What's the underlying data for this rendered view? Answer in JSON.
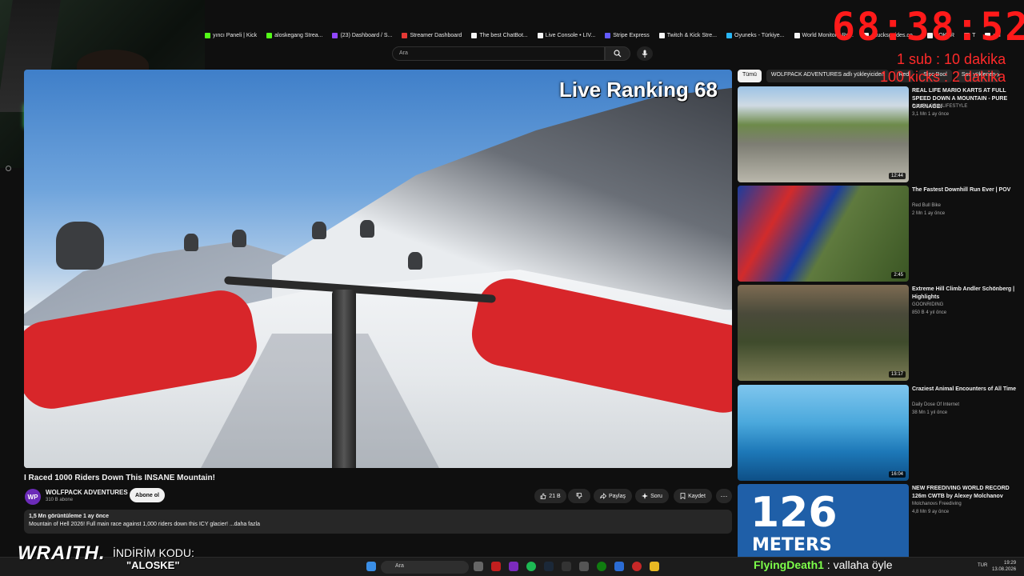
{
  "bookmarks": [
    {
      "label": "yıncı Paneli | Kick",
      "color": "#53fc18"
    },
    {
      "label": "aloskegang Strea...",
      "color": "#53fc18"
    },
    {
      "label": "(23) Dashboard / S...",
      "color": "#9146ff"
    },
    {
      "label": "Streamer Dashboard",
      "color": "#e53935"
    },
    {
      "label": "The best ChatBot...",
      "color": "#f5f5f5"
    },
    {
      "label": "Live Console • LIV...",
      "color": "#f5f5f5"
    },
    {
      "label": "Stripe Express",
      "color": "#635bff"
    },
    {
      "label": "Twitch & Kick Stre...",
      "color": "#f5f5f5"
    },
    {
      "label": "Oyuneks - Türkiye...",
      "color": "#29b6f6"
    },
    {
      "label": "World Monitor - Re...",
      "color": "#f5f5f5"
    },
    {
      "label": "chucksguides.co...",
      "color": "#f5f5f5"
    },
    {
      "label": "POKER",
      "color": "#f5f5f5"
    },
    {
      "label": "T",
      "color": "#f5f5f5"
    },
    {
      "label": "ual",
      "color": "#f5f5f5"
    }
  ],
  "search": {
    "placeholder": "Ara"
  },
  "player": {
    "overlay_title": "Live Ranking 68"
  },
  "video": {
    "title": "I Raced 1000 Riders Down This INSANE Mountain!",
    "channel_initials": "WP",
    "channel": "WOLFPACK ADVENTURES",
    "subs": "310 B abone",
    "subscribe_label": "Abone ol",
    "likes": "21 B",
    "share_label": "Paylaş",
    "ask_label": "Soru",
    "save_label": "Kaydet",
    "views_date": "1,5 Mn görüntüleme  1 ay önce",
    "description": "Mountain of Hell 2026! Full main race against 1,000 riders down this ICY glacier! ...daha fazla"
  },
  "chips": [
    "Tümü",
    "WOLFPACK ADVENTURES adlı yükleyiciden",
    "Red",
    "Sinc Bool",
    "Son yüklenen"
  ],
  "recommendations": [
    {
      "title": "REAL LIFE MARIO KARTS AT FULL SPEED DOWN A MOUNTAIN - PURE CARNAGE!",
      "channel": "SAMPILGRIMLIFESTYLE",
      "meta": "3,1 Mn  1 ay önce",
      "duration": "12:44",
      "thumb_class": "t1"
    },
    {
      "title": "The Fastest Downhill Run Ever | POV",
      "channel": "Red Bull Bike",
      "meta": "2 Mn  1 ay önce",
      "duration": "2:45",
      "thumb_class": "t2"
    },
    {
      "title": "Extreme Hill Climb Andler Schönberg | Highlights",
      "channel": "GOONRIDING",
      "meta": "850 B  4 yıl önce",
      "duration": "13:17",
      "thumb_class": "t3"
    },
    {
      "title": "Craziest Animal Encounters of All Time",
      "channel": "Daily Dose Of Internet",
      "meta": "38 Mn  1 yıl önce",
      "duration": "16:04",
      "thumb_class": "t4"
    },
    {
      "title": "NEW FREEDIVING WORLD RECORD 126m CWTB by Alexey Molchanov",
      "channel": "Molchanovs Freediving",
      "meta": "4,8 Mn  9 ay önce",
      "duration": "",
      "thumb_class": "t5",
      "thumb_text_1": "126",
      "thumb_text_2": "METERS"
    }
  ],
  "overlay": {
    "timer": "68:38:52",
    "sub_rule": "1 sub : 10 dakika",
    "kick_rule": "100 kicks : 2 dakika",
    "promo_brand": "WRAITH.",
    "promo_label": "İNDİRİM KODU:",
    "promo_code": "\"ALOSKE\""
  },
  "chat": {
    "user": "FlyingDeath1",
    "message": " : vallaha öyle"
  },
  "taskbar": {
    "search_placeholder": "Ara",
    "lang": "TUR",
    "time": "19:29",
    "date": "13.08.2026"
  }
}
